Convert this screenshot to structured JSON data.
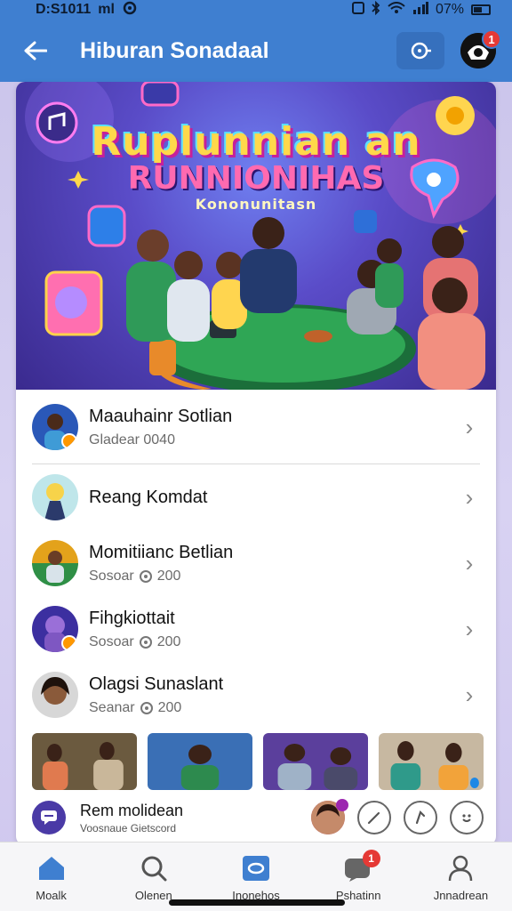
{
  "status_bar": {
    "time": "D:S1011",
    "network": "ml",
    "battery": "07%"
  },
  "app_bar": {
    "title": "Hiburan Sonadaal",
    "notification_count": "1"
  },
  "hero": {
    "title_line1": "Ruplunnian an",
    "title_line2": "RUNNIONIHAS",
    "title_line3": "Kononunitasn"
  },
  "list": [
    {
      "name": "Maauhainr Sotlian",
      "sub": "Gladear 0040",
      "has_sub_icon": false
    },
    {
      "name": "Reang Komdat",
      "sub": "",
      "has_sub_icon": false
    },
    {
      "name": "Momitiianc Betlian",
      "sub": "Sosoar",
      "count": "200",
      "has_sub_icon": true
    },
    {
      "name": "Fihgkiottait",
      "sub": "Sosoar",
      "count": "200",
      "has_sub_icon": true
    },
    {
      "name": "Olagsi Sunaslant",
      "sub": "Seanar",
      "count": "200",
      "has_sub_icon": true
    }
  ],
  "action_row": {
    "title": "Rem molidean",
    "subtitle": "Voosnaue Gietscord"
  },
  "bottom_nav": [
    {
      "label": "Moalk",
      "icon": "home-icon"
    },
    {
      "label": "Olenen",
      "icon": "search-icon"
    },
    {
      "label": "Inonehos",
      "icon": "chat-icon"
    },
    {
      "label": "Pshatinn",
      "icon": "message-icon",
      "badge": "1"
    },
    {
      "label": "Jnnadrean",
      "icon": "profile-icon"
    }
  ],
  "colors": {
    "primary": "#3f7fd0",
    "badge": "#e53935",
    "card_bg": "#ffffff"
  }
}
